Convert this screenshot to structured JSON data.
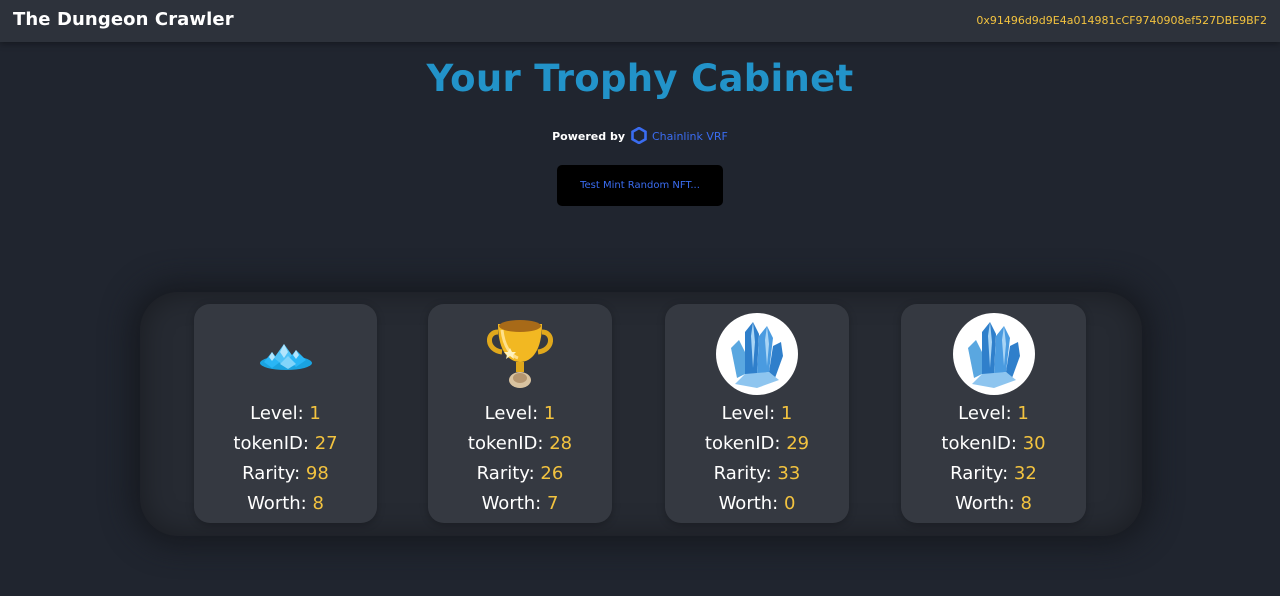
{
  "navbar": {
    "brand": "The Dungeon Crawler",
    "wallet_address": "0x91496d9d9E4a014981cCF9740908ef527DBE9BF2"
  },
  "header": {
    "title": "Your Trophy Cabinet",
    "powered_by_label": "Powered by",
    "powered_by_link": "Chainlink VRF",
    "mint_button_label": "Test Mint Random NFT..."
  },
  "cards": [
    {
      "image": "gems-icon",
      "level_label": "Level:",
      "level": "1",
      "token_label": "tokenID:",
      "token_id": "27",
      "rarity_label": "Rarity:",
      "rarity": "98",
      "worth_label": "Worth:",
      "worth": "8"
    },
    {
      "image": "trophy-icon",
      "level_label": "Level:",
      "level": "1",
      "token_label": "tokenID:",
      "token_id": "28",
      "rarity_label": "Rarity:",
      "rarity": "26",
      "worth_label": "Worth:",
      "worth": "7"
    },
    {
      "image": "crystal-icon",
      "level_label": "Level:",
      "level": "1",
      "token_label": "tokenID:",
      "token_id": "29",
      "rarity_label": "Rarity:",
      "rarity": "33",
      "worth_label": "Worth:",
      "worth": "0"
    },
    {
      "image": "crystal-icon",
      "level_label": "Level:",
      "level": "1",
      "token_label": "tokenID:",
      "token_id": "30",
      "rarity_label": "Rarity:",
      "rarity": "32",
      "worth_label": "Worth:",
      "worth": "8"
    }
  ],
  "colors": {
    "background": "#20252f",
    "navbar": "#2d323b",
    "card": "#353941",
    "title": "#2293c9",
    "accent_value": "#f3c33f",
    "link": "#3a6cf0"
  }
}
